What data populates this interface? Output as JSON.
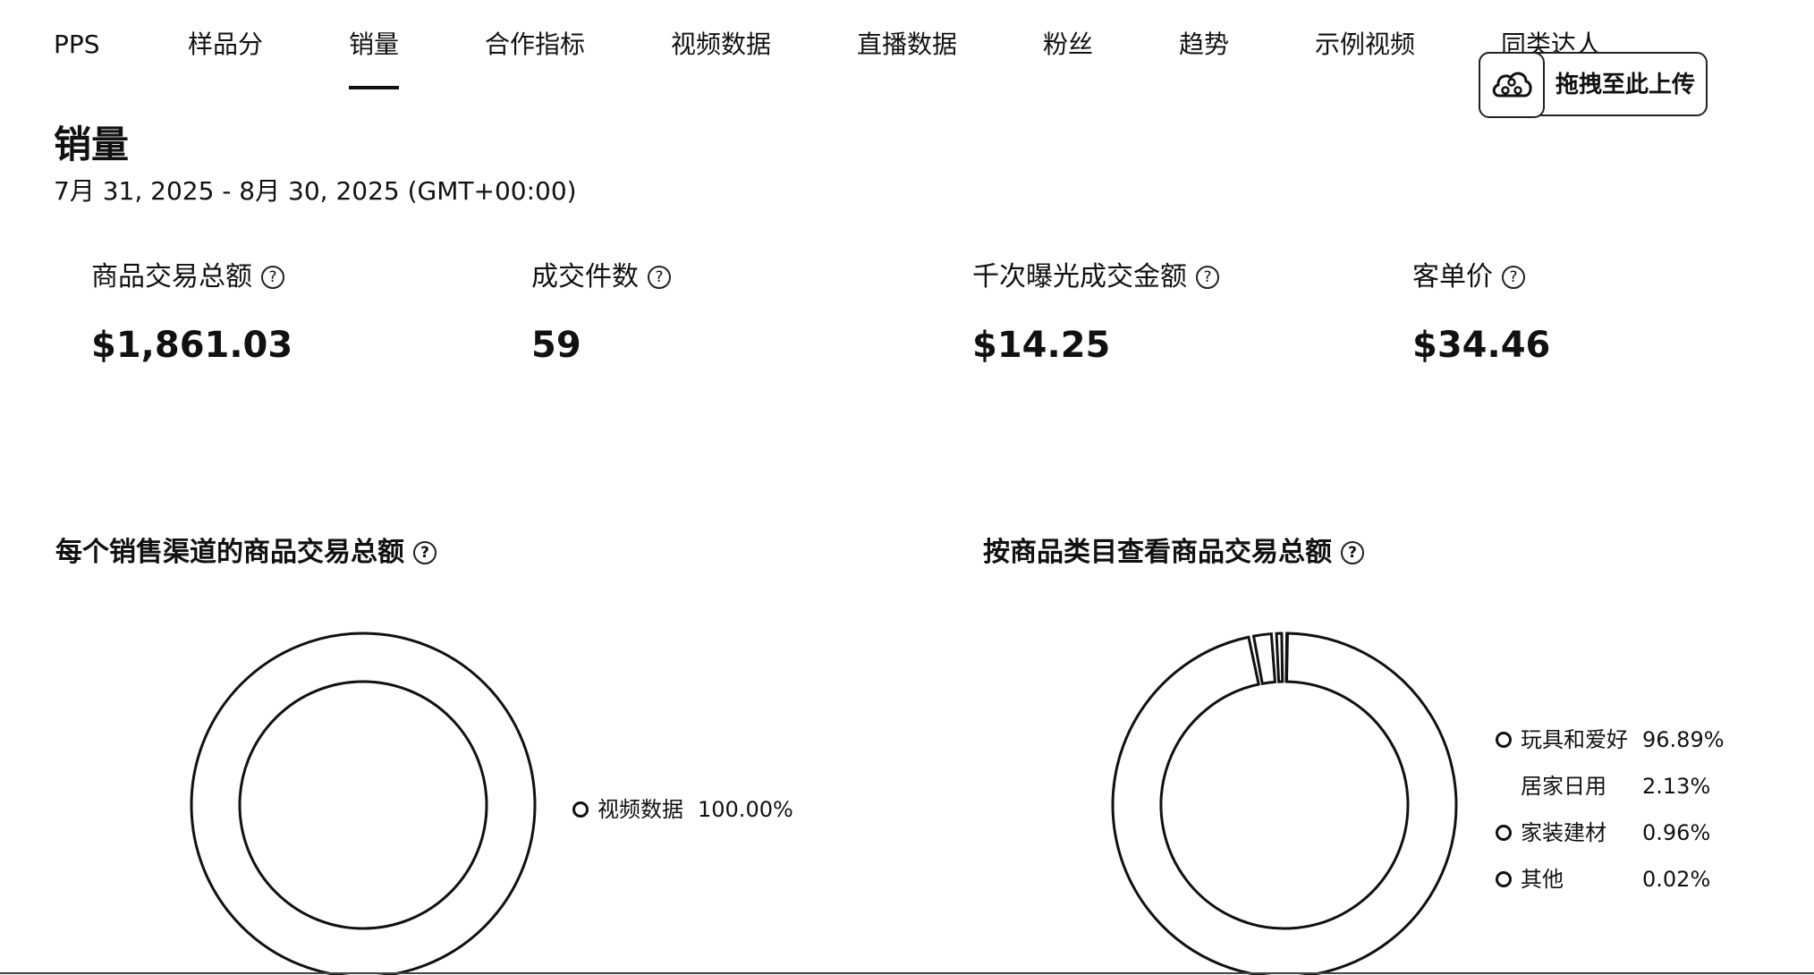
{
  "tabs": [
    {
      "label": "PPS"
    },
    {
      "label": "样品分"
    },
    {
      "label": "销量"
    },
    {
      "label": "合作指标"
    },
    {
      "label": "视频数据"
    },
    {
      "label": "直播数据"
    },
    {
      "label": "粉丝"
    },
    {
      "label": "趋势"
    },
    {
      "label": "示例视频"
    },
    {
      "label": "同类达人"
    }
  ],
  "active_tab": "销量",
  "upload_widget": {
    "label": "拖拽至此上传",
    "icon": "cloud-nodes-icon"
  },
  "section": {
    "title": "销量",
    "date_range": "7月 31, 2025 - 8月 30, 2025 (GMT+00:00)"
  },
  "kpis": [
    {
      "label": "商品交易总额",
      "value": "$1,861.03"
    },
    {
      "label": "成交件数",
      "value": "59"
    },
    {
      "label": "千次曝光成交金额",
      "value": "$14.25"
    },
    {
      "label": "客单价",
      "value": "$34.46"
    }
  ],
  "help_icon": "question-circle-icon",
  "charts": {
    "channel": {
      "title": "每个销售渠道的商品交易总额",
      "legend": [
        {
          "name": "视频数据",
          "pct": "100.00%",
          "show_dot": true
        }
      ]
    },
    "category": {
      "title": "按商品类目查看商品交易总额",
      "legend": [
        {
          "name": "玩具和爱好",
          "pct": "96.89%",
          "show_dot": true
        },
        {
          "name": "居家日用",
          "pct": "2.13%",
          "show_dot": false
        },
        {
          "name": "家装建材",
          "pct": "0.96%",
          "show_dot": true
        },
        {
          "name": "其他",
          "pct": "0.02%",
          "show_dot": true
        }
      ]
    }
  },
  "chart_data": [
    {
      "type": "pie",
      "title": "每个销售渠道的商品交易总额",
      "categories": [
        "视频数据"
      ],
      "values": [
        100.0
      ]
    },
    {
      "type": "pie",
      "title": "按商品类目查看商品交易总额",
      "categories": [
        "玩具和爱好",
        "居家日用",
        "家装建材",
        "其他"
      ],
      "values": [
        96.89,
        2.13,
        0.96,
        0.02
      ]
    }
  ]
}
